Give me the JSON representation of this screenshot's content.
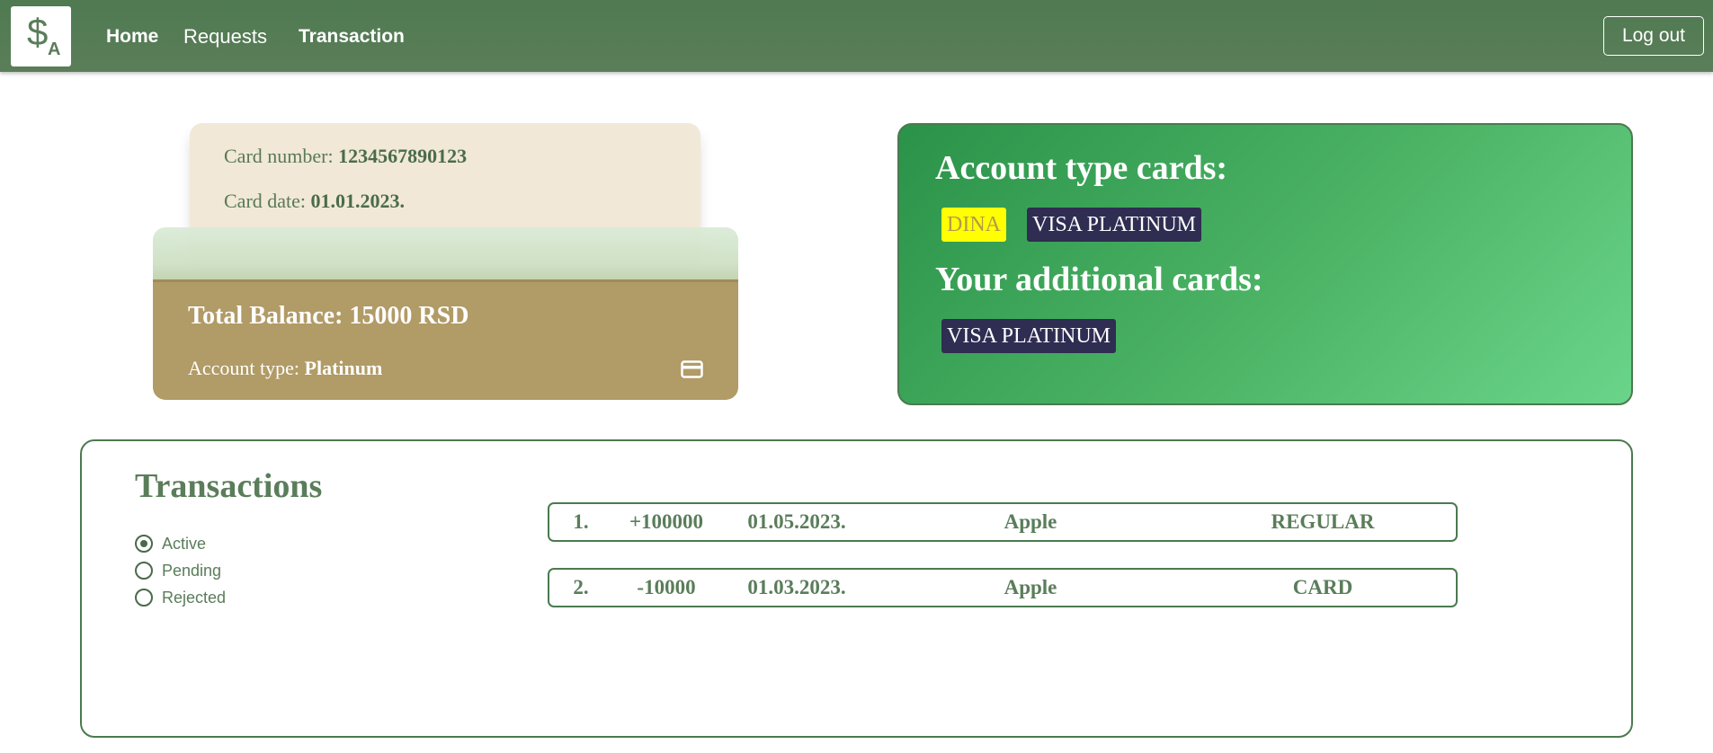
{
  "nav": {
    "home": "Home",
    "requests": "Requests",
    "transaction": "Transaction",
    "logout": "Log out"
  },
  "card": {
    "number_label": "Card number:",
    "number_value": "1234567890123",
    "date_label": "Card date:",
    "date_value": "01.01.2023.",
    "balance": "Total Balance: 15000 RSD",
    "account_type_label": "Account type:",
    "account_type_value": "Platinum",
    "icon": "credit-card-icon"
  },
  "account_cards": {
    "title": "Account type cards:",
    "badges": [
      "DINA",
      "VISA PLATINUM"
    ],
    "additional_title": "Your additional cards:",
    "additional_badges": [
      "VISA PLATINUM"
    ]
  },
  "transactions": {
    "title": "Transactions",
    "filters": [
      {
        "label": "Active",
        "checked": true
      },
      {
        "label": "Pending",
        "checked": false
      },
      {
        "label": "Rejected",
        "checked": false
      }
    ],
    "rows": [
      {
        "index": "1.",
        "amount": "+100000",
        "date": "01.05.2023.",
        "merchant": "Apple",
        "type": "REGULAR"
      },
      {
        "index": "2.",
        "amount": "-10000",
        "date": "01.03.2023.",
        "merchant": "Apple",
        "type": "CARD"
      }
    ]
  },
  "colors": {
    "nav_bg": "#557b55",
    "card_back": "#f1e8d8",
    "card_front": "#b19b66",
    "panel_green": "#3aa456",
    "badge_yellow": "#ffff00",
    "badge_dark": "#2f2d52",
    "accent_text": "#5a7d5a"
  }
}
